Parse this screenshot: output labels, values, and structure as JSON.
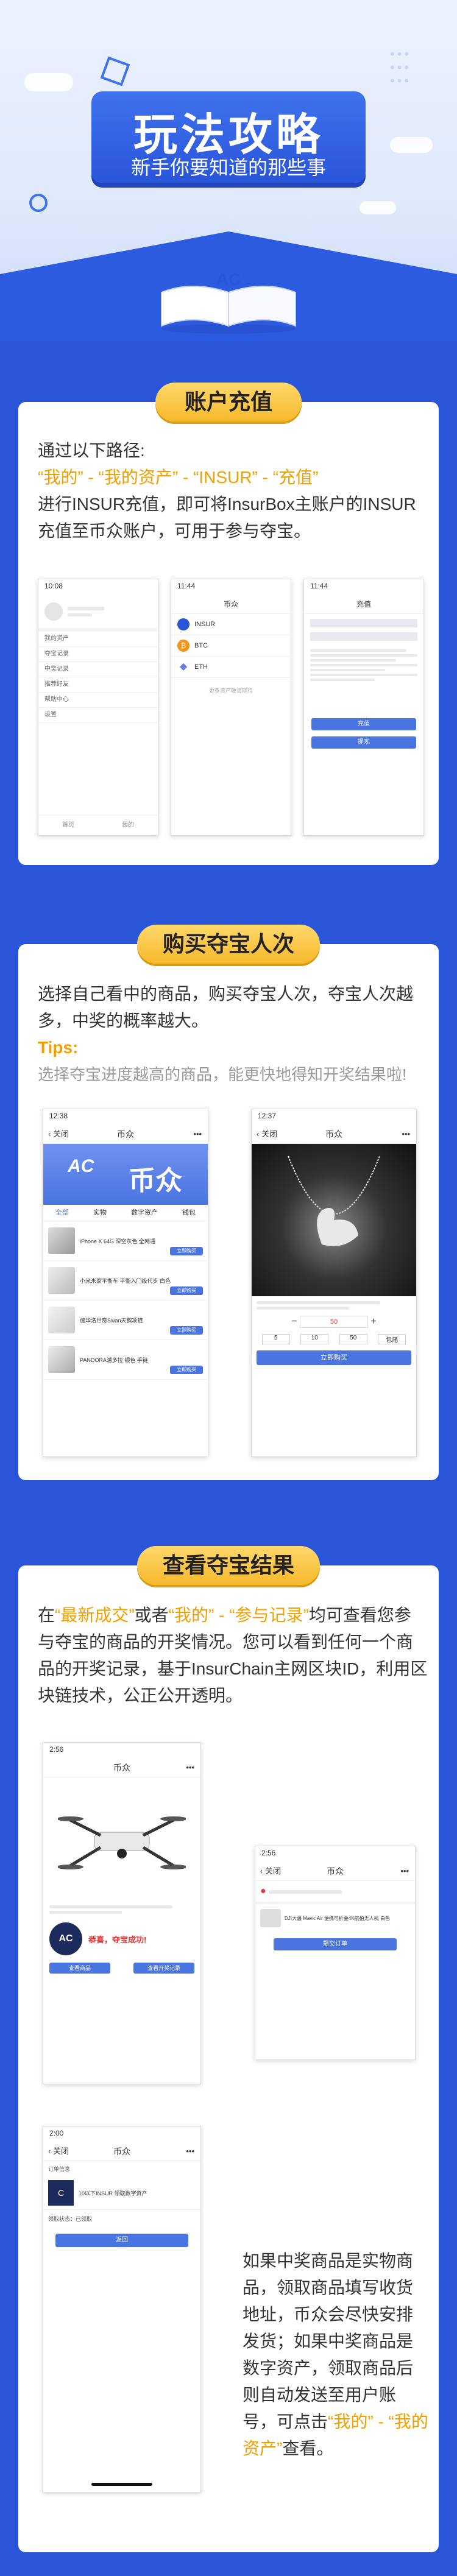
{
  "hero": {
    "title": "玩法攻略",
    "subtitle": "新手你要知道的那些事"
  },
  "section1": {
    "tag": "账户充值",
    "intro": "通过以下路径:",
    "path": "“我的” - “我的资产” - “INSUR” - “充值”",
    "body": "进行INSUR充值，即可将InsurBox主账户的INSUR充值至币众账户，可用于参与夺宝。",
    "phone1": {
      "time": "10:08",
      "rows": [
        "我的资产",
        "夺宝记录",
        "中奖记录",
        "推荐好友",
        "帮助中心",
        "设置"
      ],
      "tabs": [
        "首页",
        "我的"
      ]
    },
    "phone2": {
      "time": "11:44",
      "bar": "币众",
      "assets": [
        "INSUR",
        "BTC",
        "ETH"
      ],
      "footer": "更多资产敬请期待"
    },
    "phone3": {
      "time": "11:44",
      "bar": "充值",
      "btn1": "充值",
      "btn2": "提现"
    }
  },
  "section2": {
    "tag": "购买夺宝人次",
    "body": "选择自己看中的商品，购买夺宝人次，夺宝人次越多，中奖的概率越大。",
    "tips_title": "Tips:",
    "tips": "选择夺宝进度越高的商品，能更快地得知开奖结果啦!",
    "phoneA": {
      "time": "12:38",
      "back": "关闭",
      "bar": "币众",
      "banner_logo": "AC",
      "banner_text": "币众",
      "tabs": [
        "全部",
        "实物",
        "数字资产",
        "钱包"
      ],
      "items": [
        {
          "name": "iPhone X 64G 深空灰色 全网通",
          "btn": "立即购买"
        },
        {
          "name": "小米米家平衡车 平衡入门级代步 白色",
          "btn": "立即购买"
        },
        {
          "name": "施华洛世奇Swan天鹅项链",
          "btn": "立即购买"
        },
        {
          "name": "PANDORA潘多拉 银色 手链",
          "btn": "立即购买"
        }
      ]
    },
    "phoneB": {
      "time": "12:37",
      "back": "关闭",
      "bar": "币众",
      "qty": "50",
      "presets": [
        "5",
        "10",
        "50",
        "包尾"
      ],
      "btn": "立即购买"
    }
  },
  "section3": {
    "tag": "查看夺宝结果",
    "body_pre": "在",
    "hl1": "“最新成交”",
    "or": "或者",
    "hl2": "“我的” - “参与记录”",
    "body_post": "均可查看您参与夺宝的商品的开奖情况。您可以看到任何一个商品的开奖记录，基于InsurChain主网区块ID，利用区块链技术，公正公开透明。",
    "phoneC": {
      "time": "2:56",
      "bar": "币众",
      "win": "恭喜，夺宝成功!",
      "btn1": "查看商品",
      "btn2": "查看开奖记录"
    },
    "phoneD": {
      "time": "2:56",
      "back": "关闭",
      "bar": "币众",
      "item": "DJI大疆 Mavic Air 便携可折叠4K航拍无人机 白色",
      "btn": "提交订单"
    },
    "phoneE": {
      "time": "2:00",
      "back": "关闭",
      "bar": "币众",
      "order": "订单信息",
      "item": "10以下INSUR 领取数字资产",
      "status": "领取状态：已领取",
      "btn": "返回"
    },
    "para_pre": "如果中奖商品是实物商品，领取商品填写收货地址，币众会尽快安排发货；如果中奖商品是数字资产，领取商品后则自动发送至用户账号，可点击",
    "para_hl": "“我的” - “我的资产”",
    "para_post": "查看。"
  },
  "colors": {
    "primary": "#2a55d9",
    "accent": "#f6b92c",
    "highlight": "#f2a000"
  }
}
